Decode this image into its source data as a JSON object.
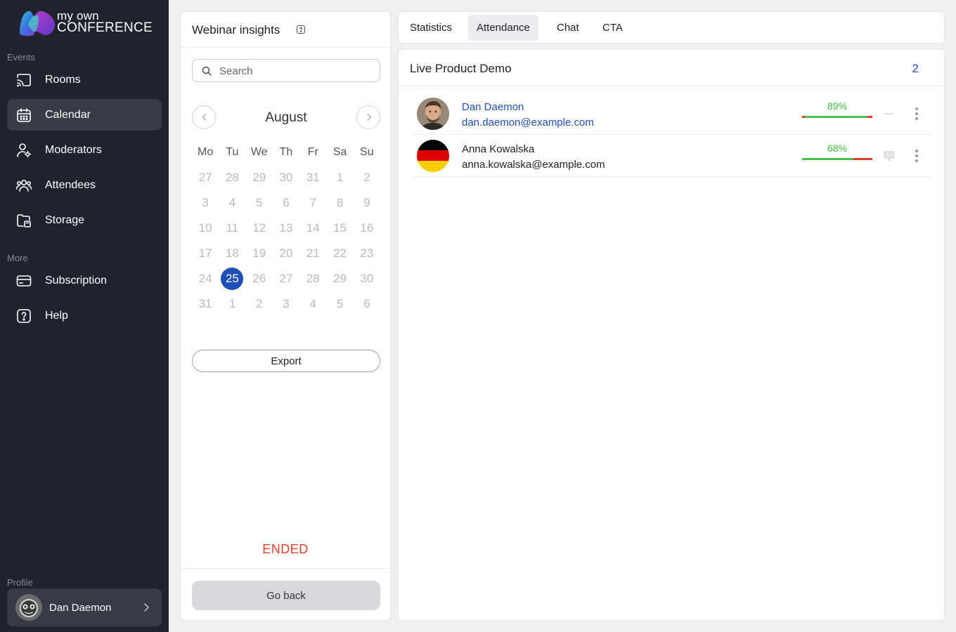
{
  "brand": {
    "line1": "my own",
    "line2": "CONFERENCE"
  },
  "sidebar": {
    "events_label": "Events",
    "more_label": "More",
    "profile_label": "Profile",
    "items": [
      {
        "label": "Rooms",
        "icon": "cast-icon"
      },
      {
        "label": "Calendar",
        "icon": "calendar-icon",
        "active": true
      },
      {
        "label": "Moderators",
        "icon": "moderator-icon"
      },
      {
        "label": "Attendees",
        "icon": "attendees-icon"
      },
      {
        "label": "Storage",
        "icon": "storage-icon"
      }
    ],
    "more_items": [
      {
        "label": "Subscription",
        "icon": "card-icon"
      },
      {
        "label": "Help",
        "icon": "help-icon"
      }
    ],
    "profile_name": "Dan Daemon"
  },
  "insights": {
    "title": "Webinar insights",
    "search_placeholder": "Search",
    "month": "August",
    "weekdays": [
      "Mo",
      "Tu",
      "We",
      "Th",
      "Fr",
      "Sa",
      "Su"
    ],
    "weeks": [
      [
        "27",
        "28",
        "29",
        "30",
        "31",
        "1",
        "2"
      ],
      [
        "3",
        "4",
        "5",
        "6",
        "7",
        "8",
        "9"
      ],
      [
        "10",
        "11",
        "12",
        "13",
        "14",
        "15",
        "16"
      ],
      [
        "17",
        "18",
        "19",
        "20",
        "21",
        "22",
        "23"
      ],
      [
        "24",
        "25",
        "26",
        "27",
        "28",
        "29",
        "30"
      ],
      [
        "31",
        "1",
        "2",
        "3",
        "4",
        "5",
        "6"
      ]
    ],
    "selected_day": "25",
    "export_label": "Export",
    "status": "ENDED",
    "go_back_label": "Go back"
  },
  "tabs": [
    {
      "label": "Statistics"
    },
    {
      "label": "Attendance",
      "active": true
    },
    {
      "label": "Chat"
    },
    {
      "label": "CTA"
    }
  ],
  "main": {
    "title": "Live Product Demo",
    "count": "2",
    "attendees": [
      {
        "name": "Dan Daemon",
        "email": "dan.daemon@example.com",
        "percent": "89%",
        "attendance": 0.89,
        "device_icon": "minus-icon",
        "highlight": true
      },
      {
        "name": "Anna Kowalska",
        "email": "anna.kowalska@example.com",
        "percent": "68%",
        "attendance": 0.68,
        "device_icon": "monitor-icon",
        "highlight": false
      }
    ]
  },
  "colors": {
    "accent": "#1f4fb8",
    "ended": "#e0402a",
    "progress_good": "#4cbf4c",
    "progress_bad": "#e53a2e",
    "sidebar_bg": "#22222e"
  }
}
